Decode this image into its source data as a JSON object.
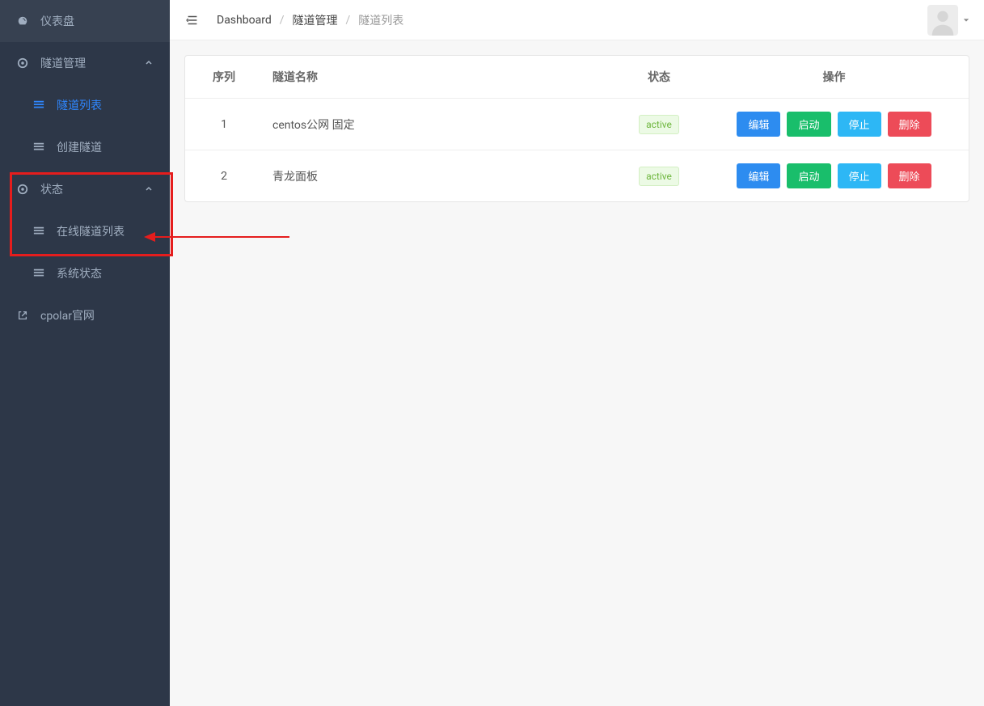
{
  "sidebar": {
    "items": [
      {
        "label": "仪表盘",
        "icon": "dashboard"
      },
      {
        "label": "隧道管理",
        "icon": "circle-target",
        "expandable": true
      },
      {
        "label": "隧道列表",
        "icon": "table",
        "sub": true,
        "active": true
      },
      {
        "label": "创建隧道",
        "icon": "table",
        "sub": true
      },
      {
        "label": "状态",
        "icon": "circle-target",
        "expandable": true
      },
      {
        "label": "在线隧道列表",
        "icon": "table",
        "sub": true
      },
      {
        "label": "系统状态",
        "icon": "table",
        "sub": true
      },
      {
        "label": "cpolar官网",
        "icon": "external"
      }
    ]
  },
  "breadcrumb": {
    "items": [
      "Dashboard",
      "隧道管理",
      "隧道列表"
    ]
  },
  "table": {
    "headers": {
      "seq": "序列",
      "name": "隧道名称",
      "status": "状态",
      "actions": "操作"
    },
    "rows": [
      {
        "seq": "1",
        "name": "centos公网 固定",
        "status": "active"
      },
      {
        "seq": "2",
        "name": "青龙面板",
        "status": "active"
      }
    ],
    "action_labels": {
      "edit": "编辑",
      "start": "启动",
      "stop": "停止",
      "delete": "删除"
    }
  },
  "colors": {
    "sidebar_bg": "#2d3748",
    "active_link": "#2f87ff",
    "btn_blue": "#2d8cf0",
    "btn_green": "#19be6b",
    "btn_cyan": "#2db7f5",
    "btn_red": "#ed4b58",
    "status_green": "#6fb73f"
  }
}
